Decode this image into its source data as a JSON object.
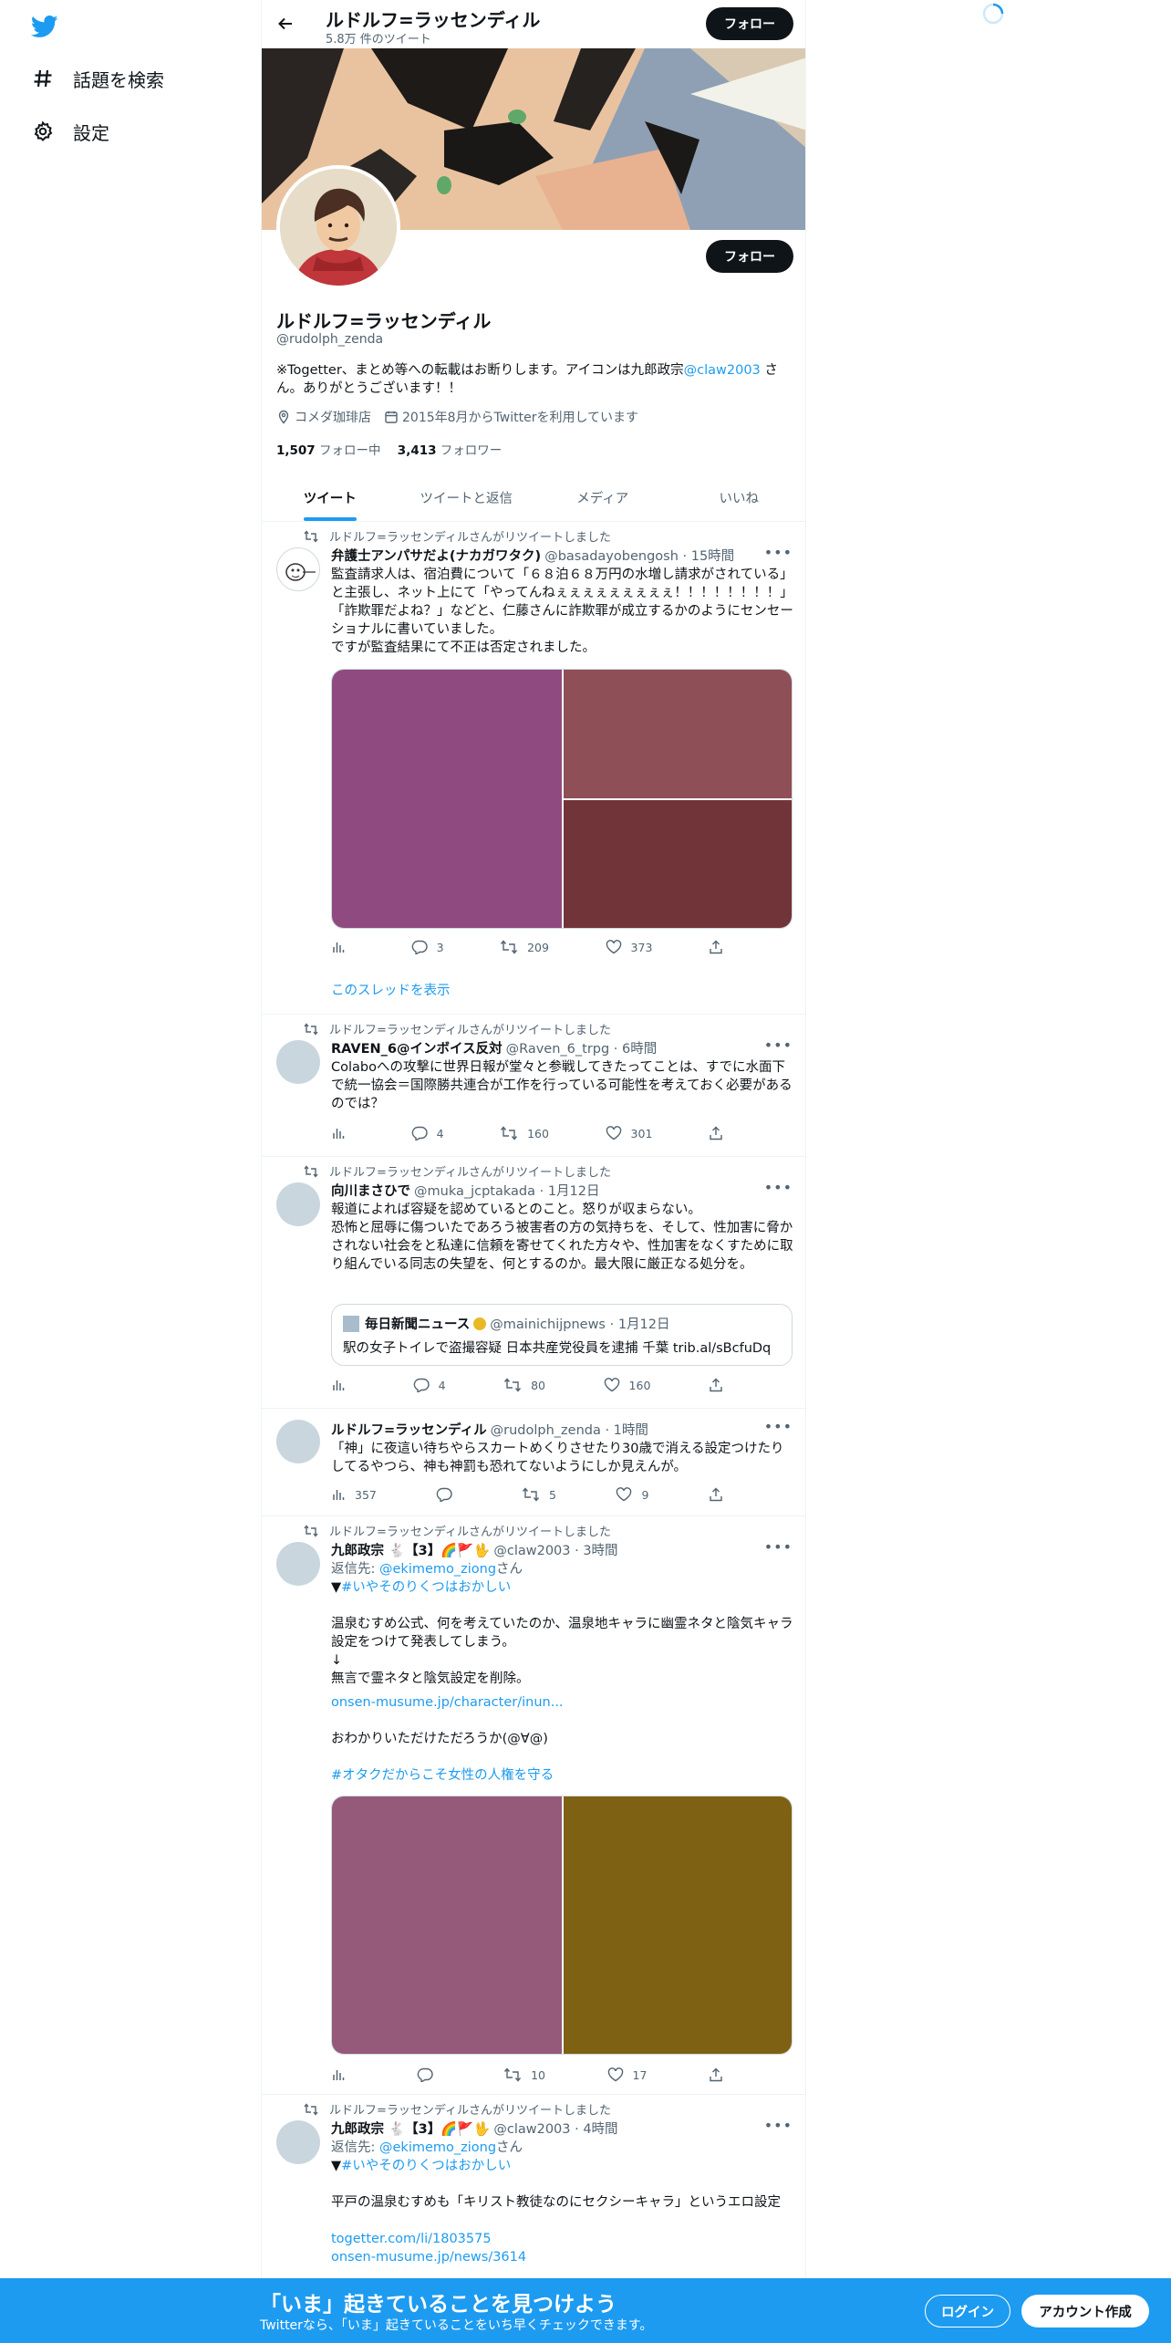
{
  "nav": {
    "items": [
      {
        "label": "話題を検索",
        "icon": "hashtag-icon"
      },
      {
        "label": "設定",
        "icon": "gear-icon"
      }
    ]
  },
  "topbar": {
    "title": "ルドルフ=ラッセンディル",
    "subtitle": "5.8万 件のツイート",
    "follow_label": "フォロー"
  },
  "profile": {
    "follow_label": "フォロー",
    "name": "ルドルフ=ラッセンディル",
    "handle": "@rudolph_zenda",
    "bio_pre": "※Togetter、まとめ等への転載はお断りします。アイコンは九郎政宗",
    "bio_link": "@claw2003",
    "bio_post": " さん。ありがとうございます！！",
    "location": "コメダ珈琲店",
    "joined": "2015年8月からTwitterを利用しています",
    "following_count": "1,507",
    "following_label": " フォロー中",
    "followers_count": "3,413",
    "followers_label": " フォロワー"
  },
  "tabs": [
    "ツイート",
    "ツイートと返信",
    "メディア",
    "いいね"
  ],
  "tweets": [
    {
      "retweet_note": "ルドルフ=ラッセンディルさんがリツイートしました",
      "name": "弁護士アンパサだよ(ナカガワタク)",
      "handle": "@basadayobengosh · 15時間",
      "text": "監査請求人は、宿泊費について「６８泊６８万円の水増し請求がされている」と主張し、ネット上にて「やってんねぇぇぇぇぇぇぇぇぇ！！！！！！！！」「詐欺罪だよね？」などと、仁藤さんに詐欺罪が成立するかのようにセンセーショナルに書いていました。\nですが監査結果にて不正は否定されました。",
      "media_colors": [
        "#8f4b80",
        "#8f4f56",
        "#713438"
      ],
      "replies": "3",
      "retweets": "209",
      "likes": "373",
      "thread_link": "このスレッドを表示"
    },
    {
      "retweet_note": "ルドルフ=ラッセンディルさんがリツイートしました",
      "name": "RAVEN_6@インボイス反対",
      "handle": "@Raven_6_trpg · 6時間",
      "text": "Colaboへの攻撃に世界日報が堂々と参戦してきたってことは、すでに水面下で統一協会＝国際勝共連合が工作を行っている可能性を考えておく必要があるのでは？",
      "replies": "4",
      "retweets": "160",
      "likes": "301"
    },
    {
      "retweet_note": "ルドルフ=ラッセンディルさんがリツイートしました",
      "name": "向川まさひで",
      "handle": "@muka_jcptakada · 1月12日",
      "text": "報道によれば容疑を認めているとのこと。怒りが収まらない。\n恐怖と屈辱に傷ついたであろう被害者の方の気持ちを、そして、性加害に脅かされない社会をと私達に信頼を寄せてくれた方々や、性加害をなくすために取り組んでいる同志の失望を、何とするのか。最大限に厳正なる処分を。",
      "quote": {
        "name": "毎日新聞ニュース",
        "handle": "@mainichijpnews · 1月12日",
        "text": "駅の女子トイレで盗撮容疑 日本共産党役員を逮捕 千葉 trib.al/sBcfuDq"
      },
      "replies": "4",
      "retweets": "80",
      "likes": "160"
    },
    {
      "name": "ルドルフ=ラッセンディル",
      "handle": "@rudolph_zenda · 1時間",
      "text": "「神」に夜這い待ちやらスカートめくりさせたり30歳で消える設定つけたりしてるやつら、神も神罰も恐れてないようにしか見えんが。",
      "views": "357",
      "replies": "",
      "retweets": "5",
      "likes": "9"
    },
    {
      "retweet_note": "ルドルフ=ラッセンディルさんがリツイートしました",
      "name": "九郎政宗 🐇【3】🌈🚩🖖",
      "handle": "@claw2003 · 3時間",
      "reply_prefix": "返信先: ",
      "reply_to": "@ekimemo_ziong",
      "reply_suffix": "さん",
      "tag_line_prefix": "▼",
      "tag_line_link": "#いやそのりくつはおかしい",
      "text": "温泉むすめ公式、何を考えていたのか、温泉地キャラに幽霊ネタと陰気キャラ設定をつけて発表してしまう。\n↓\n無言で霊ネタと陰気設定を削除。",
      "link1": "onsen-musume.jp/character/inun...",
      "text2": "おわかりいただけただろうか(@∀@)",
      "hashtag": "#オタクだからこそ女性の人権を守る",
      "media_colors": [
        "#95597a",
        "#7f6113"
      ],
      "replies": "",
      "retweets": "10",
      "likes": "17"
    },
    {
      "retweet_note": "ルドルフ=ラッセンディルさんがリツイートしました",
      "name": "九郎政宗 🐇【3】🌈🚩🖖",
      "handle": "@claw2003 · 4時間",
      "reply_prefix": "返信先: ",
      "reply_to": "@ekimemo_ziong",
      "reply_suffix": "さん",
      "tag_line_prefix": "▼",
      "tag_line_link": "#いやそのりくつはおかしい",
      "text": "平戸の温泉むすめも「キリスト教徒なのにセクシーキャラ」というエロ設定",
      "link1": "togetter.com/li/1803575",
      "link2": "onsen-musume.jp/news/3614"
    }
  ],
  "bottom": {
    "title": "「いま」起きていることを見つけよう",
    "subtitle": "Twitterなら、「いま」起きていることをいち早くチェックできます。",
    "login": "ログイン",
    "signup": "アカウント作成"
  },
  "colors": {
    "accent": "#1d9bf0",
    "text": "#0f1419",
    "muted": "#536471"
  }
}
